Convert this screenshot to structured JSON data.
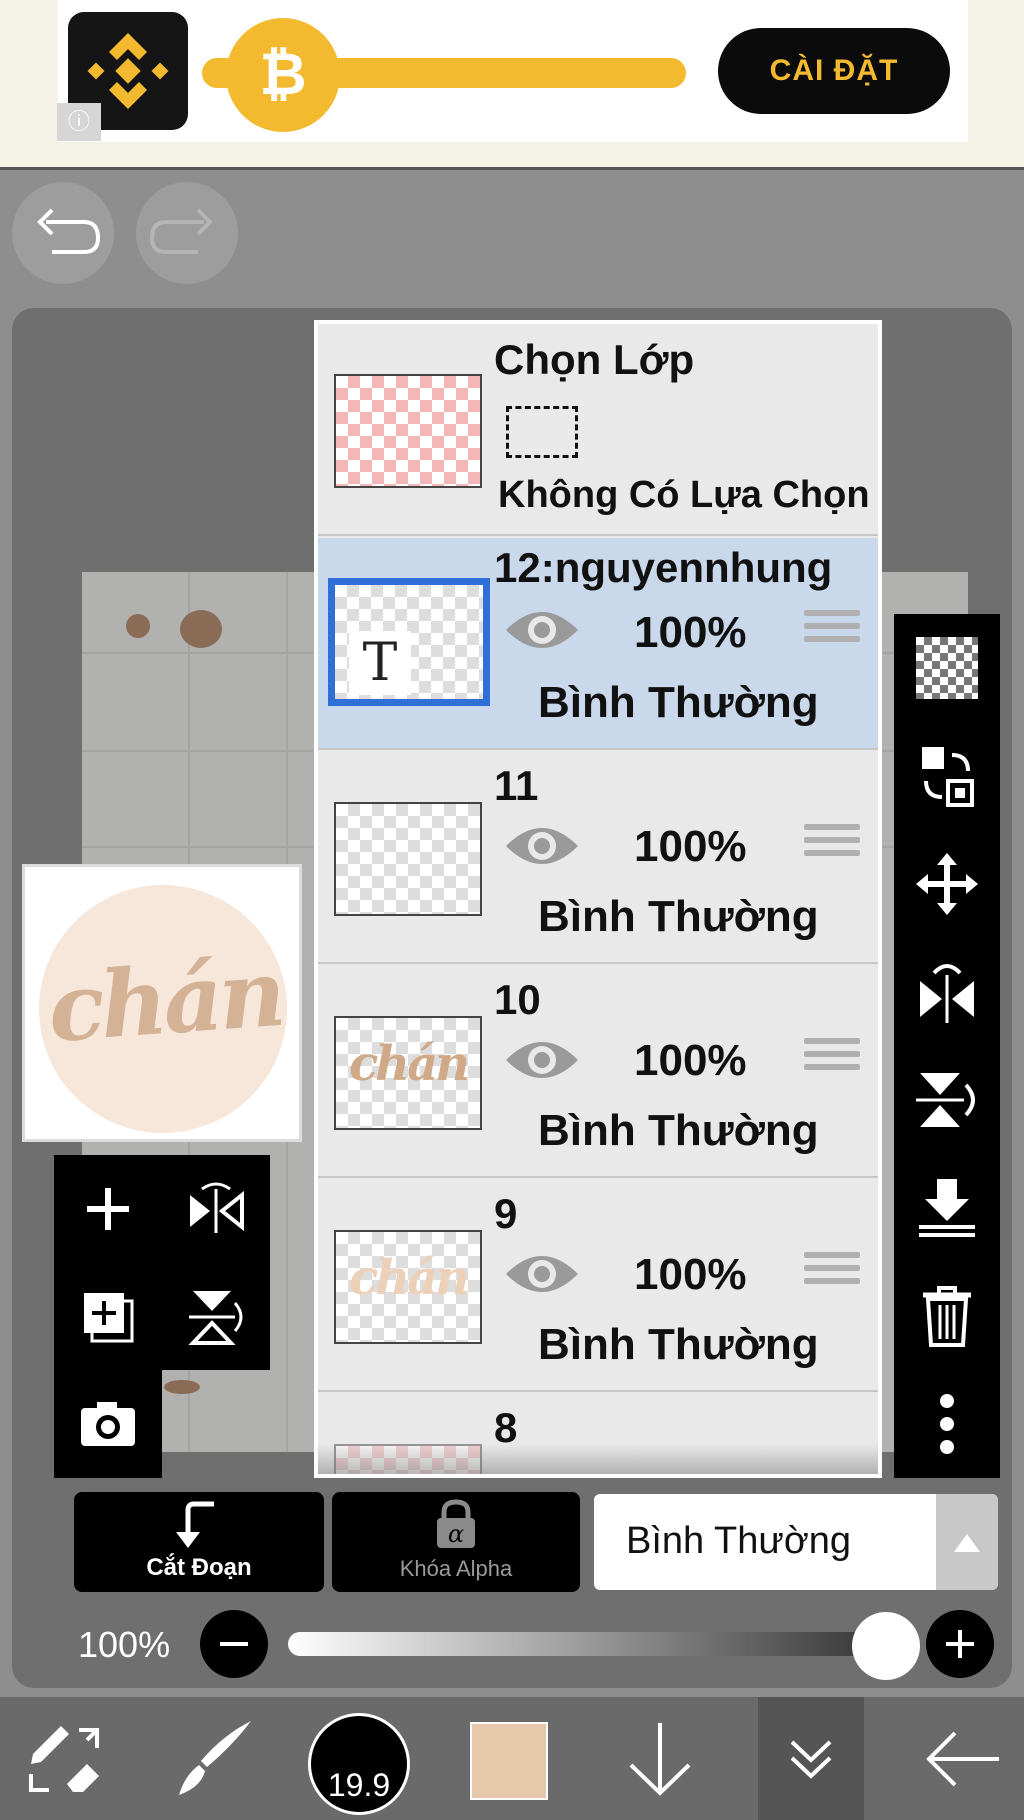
{
  "ad": {
    "cta_label": "CÀI ĐẶT",
    "info_glyph": "ⓘ",
    "brand_color": "#f3ba2f",
    "logo_icon": "binance-logo",
    "knob_icon": "bitcoin-icon"
  },
  "toolbar_top": {
    "undo_icon": "undo-icon",
    "redo_icon": "redo-icon"
  },
  "layers_panel": {
    "selection_row": {
      "title": "Chọn Lớp",
      "subtitle": "Không Có Lựa Chọn"
    },
    "layers": [
      {
        "name": "12:nguyennhung",
        "opacity": "100%",
        "mode": "Bình Thường",
        "selected": true,
        "thumb_text": "T"
      },
      {
        "name": "11",
        "opacity": "100%",
        "mode": "Bình Thường",
        "selected": false,
        "thumb_text": ""
      },
      {
        "name": "10",
        "opacity": "100%",
        "mode": "Bình Thường",
        "selected": false,
        "thumb_text": "chán"
      },
      {
        "name": "9",
        "opacity": "100%",
        "mode": "Bình Thường",
        "selected": false,
        "thumb_text": "chán"
      },
      {
        "name": "8",
        "opacity": "",
        "mode": "",
        "selected": false,
        "thumb_text": ""
      }
    ]
  },
  "preview": {
    "text": "chán"
  },
  "controls": {
    "clip_label": "Cắt Đoạn",
    "alpha_lock_label": "Khóa Alpha",
    "blend_mode": "Bình Thường",
    "opacity_label": "100%",
    "opacity_value": 1.0
  },
  "bottom_bar": {
    "brush_size": "19.9",
    "color_swatch": "#e6c9ab"
  }
}
